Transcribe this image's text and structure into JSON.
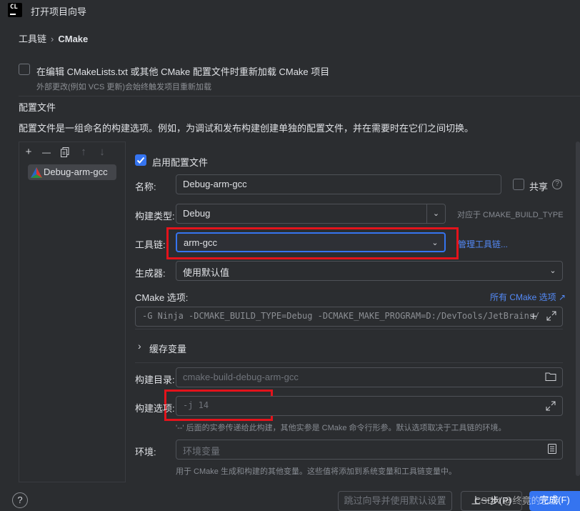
{
  "window": {
    "title": "打开项目向导",
    "logo": "CL"
  },
  "breadcrumb": {
    "parent": "工具链",
    "separator": "›",
    "current": "CMake"
  },
  "reload": {
    "label": "在编辑 CMakeLists.txt 或其他 CMake 配置文件时重新加载 CMake 项目",
    "hint": "外部更改(例如 VCS 更新)会始终触发项目重新加载",
    "checked": false
  },
  "profiles": {
    "heading": "配置文件",
    "description": "配置文件是一组命名的构建选项。例如，为调试和发布构建创建单独的配置文件，并在需要时在它们之间切换。",
    "toolbar": {
      "add": "+",
      "remove": "—",
      "copy": "copy-icon",
      "up": "↑",
      "down": "↓"
    },
    "items": [
      {
        "label": "Debug-arm-gcc",
        "icon": "cmake-triangle-icon"
      }
    ]
  },
  "form": {
    "enable_label": "启用配置文件",
    "enabled": true,
    "name": {
      "label": "名称:",
      "value": "Debug-arm-gcc"
    },
    "share": {
      "label": "共享",
      "help": "?"
    },
    "build_type": {
      "label": "构建类型:",
      "value": "Debug",
      "hint": "对应于 CMAKE_BUILD_TYPE"
    },
    "toolchain": {
      "label": "工具链:",
      "value": "arm-gcc",
      "link": "管理工具链..."
    },
    "generator": {
      "label": "生成器:",
      "value": "使用默认值"
    },
    "cmake_options": {
      "label": "CMake 选项:",
      "link": "所有 CMake 选项 ↗",
      "value": "-G Ninja -DCMAKE_BUILD_TYPE=Debug -DCMAKE_MAKE_PROGRAM=D:/DevTools/JetBrains/"
    },
    "cache_vars": {
      "label": "缓存变量",
      "chevron": "›"
    },
    "build_dir": {
      "label": "构建目录:",
      "placeholder": "cmake-build-debug-arm-gcc"
    },
    "build_options": {
      "label": "构建选项:",
      "placeholder": "-j 14",
      "hint": "'--' 后面的实参传递给此构建，其他实参是 CMake 命令行形参。默认选项取决于工具链的环境。"
    },
    "environment": {
      "label": "环境:",
      "placeholder": "环境变量",
      "hint": "用于 CMake 生成和构建的其他变量。这些值将添加到系统变量和工具链变量中。"
    }
  },
  "footer": {
    "help": "?",
    "skip_label": "跳过向导并使用默认设置",
    "prev_label": "上一步(P)",
    "finish_label": "完成(F)",
    "watermark": "CSDN @终竟的艺游"
  },
  "colors": {
    "accent": "#3574f0",
    "highlight": "#e3131b",
    "link": "#548af7",
    "background": "#2b2d30"
  }
}
